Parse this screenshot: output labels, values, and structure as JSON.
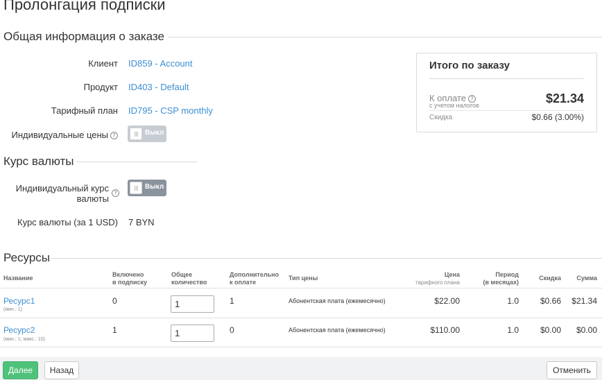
{
  "page": {
    "title": "Пролонгация подписки"
  },
  "general": {
    "section_title": "Общая информация о заказе",
    "client_label": "Клиент",
    "client_value": "ID859 - Account",
    "product_label": "Продукт",
    "product_value": "ID403 - Default",
    "plan_label": "Тарифный план",
    "plan_value": "ID795 - CSP monthly",
    "individual_prices_label": "Индивидуальные цены",
    "individual_prices_toggle": "Выкл"
  },
  "currency": {
    "section_title": "Курс валюты",
    "individual_rate_label": "Индивидуальный курс валюты",
    "individual_rate_toggle": "Выкл",
    "rate_label": "Курс валюты (за 1 USD)",
    "rate_value": "7 BYN"
  },
  "summary": {
    "title": "Итого по заказу",
    "pay_label": "К оплате",
    "pay_sub": "с учетом налогов",
    "amount": "$21.34",
    "discount_label": "Скидка",
    "discount_value": "$0.66 (3.00%)"
  },
  "resources": {
    "section_title": "Ресурсы",
    "headers": {
      "name": "Название",
      "included_1": "Включено",
      "included_2": "в подписку",
      "total_1": "Общее",
      "total_2": "количество",
      "additional_1": "Дополнительно",
      "additional_2": "к оплате",
      "price_type": "Тип цены",
      "price": "Цена",
      "price_sub": "тарифного плана",
      "period": "Период",
      "period_sub": "(в месяцах)",
      "discount": "Скидка",
      "sum": "Сумма"
    },
    "rows": [
      {
        "name": "Ресурс1",
        "limits": "(мин.: 1)",
        "included": "0",
        "quantity": "1",
        "additional": "1",
        "price_type": "Абонентская плата (ежемесячно)",
        "price": "$22.00",
        "period": "1.0",
        "discount": "$0.66",
        "sum": "$21.34"
      },
      {
        "name": "Ресурс2",
        "limits": "(мин.: 1; макс.: 10)",
        "included": "1",
        "quantity": "1",
        "additional": "0",
        "price_type": "Абонентская плата (ежемесячно)",
        "price": "$110.00",
        "period": "1.0",
        "discount": "$0.00",
        "sum": "$0.00"
      }
    ]
  },
  "footer": {
    "next_label": "Далее",
    "back_label": "Назад",
    "cancel_label": "Отменить"
  },
  "icons": {
    "help": "question-circle-icon",
    "toggle_knob": "toggle-knob-icon"
  },
  "colors": {
    "link": "#3b8ed1",
    "primary_button": "#4ec27a",
    "toggle_off": "#c7ccd3",
    "toggle_off_dark": "#8a929d"
  }
}
